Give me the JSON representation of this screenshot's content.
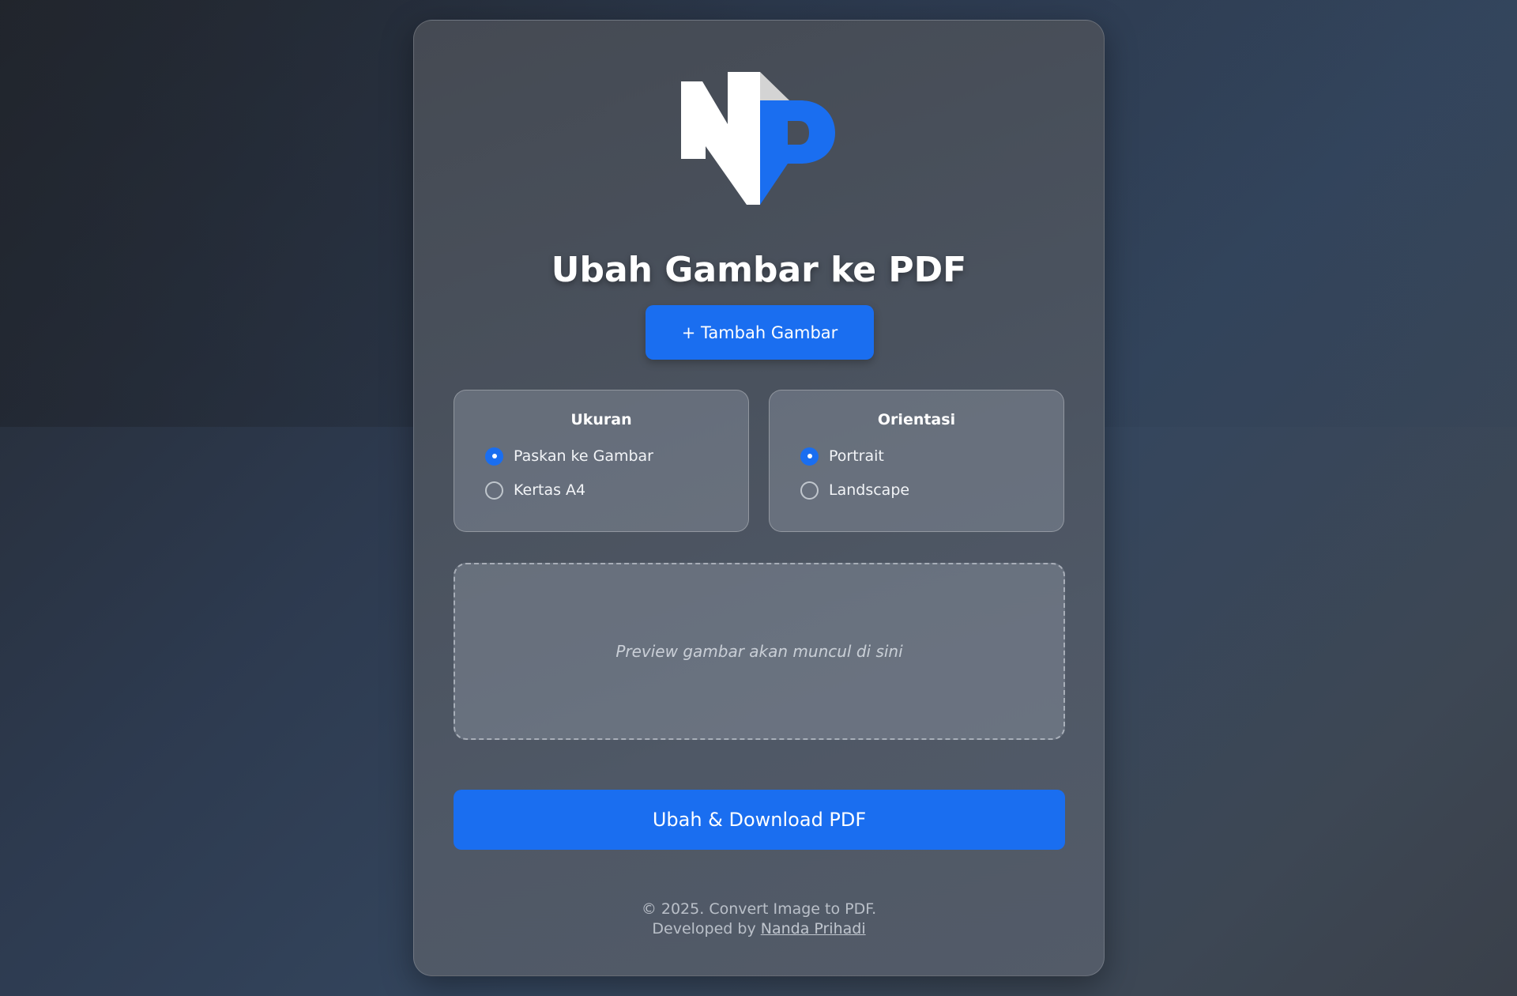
{
  "logo": {
    "text": "NP",
    "colors": {
      "n": "#ffffff",
      "p": "#1a6ef0",
      "fold": "#d0d0d0"
    }
  },
  "header": {
    "title": "Ubah Gambar ke PDF"
  },
  "add_button": {
    "label": "+ Tambah Gambar"
  },
  "options": {
    "size": {
      "title": "Ukuran",
      "items": [
        {
          "label": "Paskan ke Gambar",
          "selected": true
        },
        {
          "label": "Kertas A4",
          "selected": false
        }
      ]
    },
    "orientation": {
      "title": "Orientasi",
      "items": [
        {
          "label": "Portrait",
          "selected": true
        },
        {
          "label": "Landscape",
          "selected": false
        }
      ]
    }
  },
  "preview": {
    "placeholder": "Preview gambar akan muncul di sini"
  },
  "convert_button": {
    "label": "Ubah & Download PDF"
  },
  "footer": {
    "line1": "© 2025. Convert Image to PDF.",
    "developed_prefix": "Developed by",
    "developer_name": "Nanda Prihadi"
  },
  "colors": {
    "accent": "#1a6ef0"
  }
}
